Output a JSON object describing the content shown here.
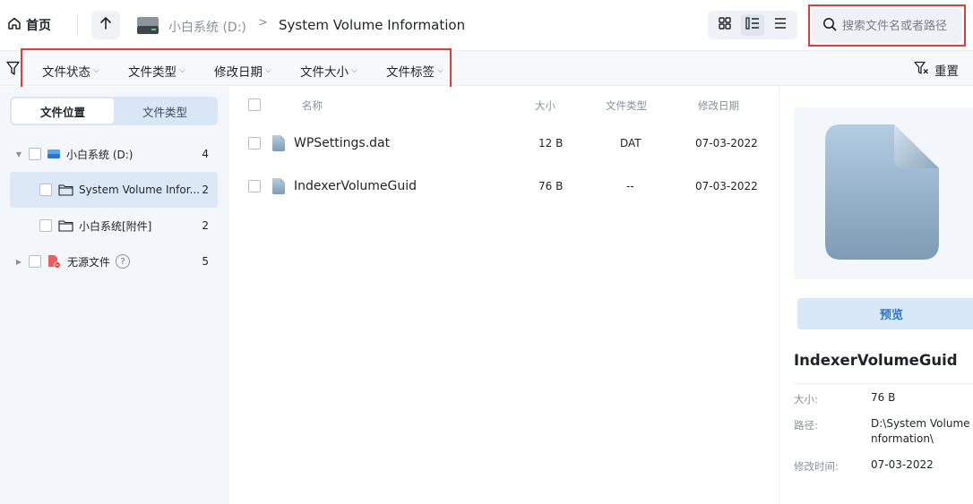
{
  "topbar": {
    "home_label": "首页",
    "drive_label": "小白系统 (D:)",
    "breadcrumb_separator": ">",
    "current_folder": "System Volume Information",
    "search_placeholder": "搜索文件名或者路径"
  },
  "filters": {
    "items": [
      "文件状态",
      "文件类型",
      "修改日期",
      "文件大小",
      "文件标签"
    ],
    "reset_label": "重置"
  },
  "sidebar": {
    "tabs": [
      "文件位置",
      "文件类型"
    ],
    "tree": [
      {
        "label": "小白系统 (D:)",
        "count": "4"
      },
      {
        "label": "System Volume Infor...",
        "count": "2"
      },
      {
        "label": "小白系统[附件]",
        "count": "2"
      },
      {
        "label": "无源文件",
        "count": "5",
        "help": "?"
      }
    ]
  },
  "filelist": {
    "headers": {
      "name": "名称",
      "size": "大小",
      "type": "文件类型",
      "date": "修改日期"
    },
    "rows": [
      {
        "name": "WPSettings.dat",
        "size": "12 B",
        "type": "DAT",
        "date": "07-03-2022"
      },
      {
        "name": "IndexerVolumeGuid",
        "size": "76 B",
        "type": "--",
        "date": "07-03-2022"
      }
    ]
  },
  "detail": {
    "preview_label": "预览",
    "file_name": "IndexerVolumeGuid",
    "size_label": "大小:",
    "size_value": "76 B",
    "path_label": "路径:",
    "path_value": "D:\\System Volume Information\\",
    "date_label": "修改时间:",
    "date_value": "07-03-2022"
  },
  "colors": {
    "accent": "#2b74c8",
    "highlight_box": "#e03c3c",
    "sidebar_bg": "#f3f6fa",
    "selected_row": "#dde8f6"
  }
}
